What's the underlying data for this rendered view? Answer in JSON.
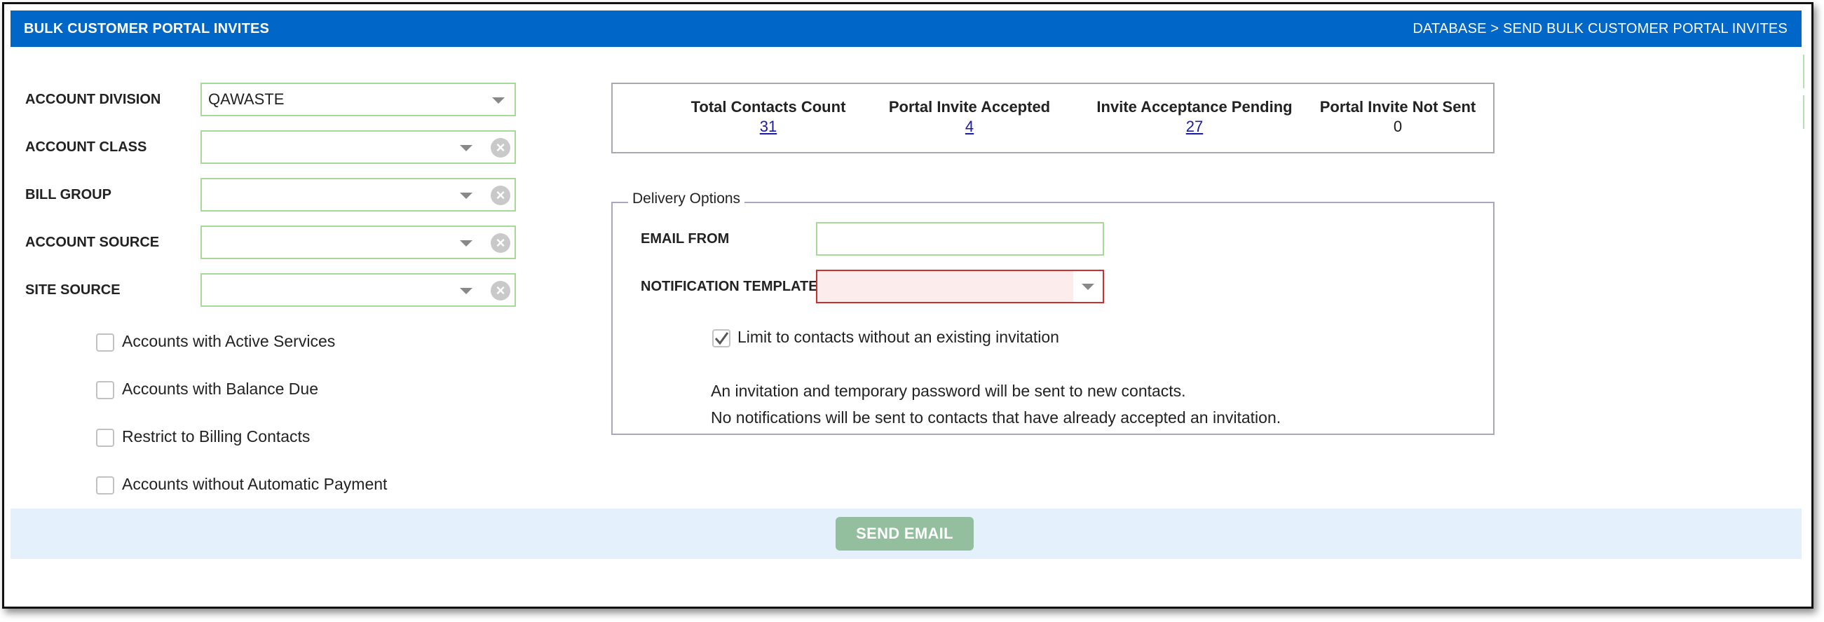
{
  "header": {
    "title": "BULK CUSTOMER PORTAL INVITES",
    "breadcrumb": "DATABASE > SEND BULK CUSTOMER PORTAL INVITES"
  },
  "filters": [
    {
      "label": "ACCOUNT DIVISION",
      "value": "QAWASTE",
      "clearable": false
    },
    {
      "label": "ACCOUNT CLASS",
      "value": "",
      "clearable": true
    },
    {
      "label": "BILL GROUP",
      "value": "",
      "clearable": true
    },
    {
      "label": "ACCOUNT SOURCE",
      "value": "",
      "clearable": true
    },
    {
      "label": "SITE SOURCE",
      "value": "",
      "clearable": true
    }
  ],
  "checkboxes": [
    {
      "label": "Accounts with Active Services",
      "checked": false
    },
    {
      "label": "Accounts with Balance Due",
      "checked": false
    },
    {
      "label": "Restrict to Billing Contacts",
      "checked": false
    },
    {
      "label": "Accounts without Automatic Payment",
      "checked": false
    }
  ],
  "stats": [
    {
      "label": "Total Contacts Count",
      "value": "31",
      "link": true
    },
    {
      "label": "Portal Invite Accepted",
      "value": "4",
      "link": true
    },
    {
      "label": "Invite Acceptance Pending",
      "value": "27",
      "link": true
    },
    {
      "label": "Portal Invite Not Sent",
      "value": "0",
      "link": false
    }
  ],
  "delivery": {
    "legend": "Delivery Options",
    "email_from_label": "EMAIL FROM",
    "email_from_value": "",
    "template_label": "NOTIFICATION TEMPLATE",
    "template_value": "",
    "limit_label": "Limit to contacts without an existing invitation",
    "limit_checked": true,
    "note1": "An invitation and temporary password will be sent to new contacts.",
    "note2": "No notifications will be sent to contacts that have already accepted an invitation."
  },
  "footer": {
    "send_label": "SEND EMAIL"
  },
  "colors": {
    "header_bg": "#0067c8",
    "valid_border": "#a9d99a",
    "invalid_border": "#cc2f2f",
    "invalid_bg": "#fcecec",
    "button_bg": "#93bf9e",
    "footer_bg": "#e4f1fc"
  }
}
